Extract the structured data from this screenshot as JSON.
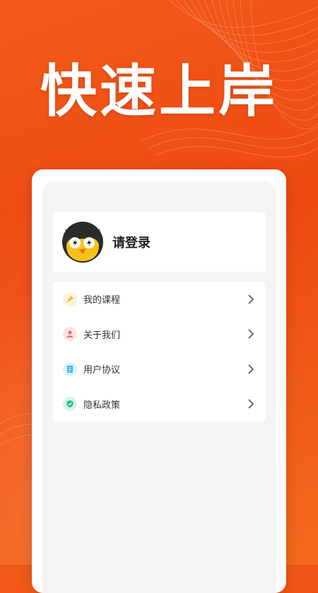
{
  "promo": {
    "headline": "快速上岸"
  },
  "profile": {
    "login_prompt": "请登录",
    "avatar_icon": "owl-mascot-icon"
  },
  "menu": {
    "items": [
      {
        "label": "我的课程",
        "icon": "pin-icon",
        "icon_color": "#f3b62b",
        "icon_bg": "#fdf3d8"
      },
      {
        "label": "关于我们",
        "icon": "person-icon",
        "icon_color": "#ef6b6b",
        "icon_bg": "#fde4e4"
      },
      {
        "label": "用户协议",
        "icon": "document-icon",
        "icon_color": "#3eb0ea",
        "icon_bg": "#ddf1fb"
      },
      {
        "label": "隐私政策",
        "icon": "shield-icon",
        "icon_color": "#23c47e",
        "icon_bg": "#d8f5e8"
      }
    ]
  },
  "colors": {
    "brand": "#ee4a12",
    "screen_bg": "#f4f4f4"
  }
}
